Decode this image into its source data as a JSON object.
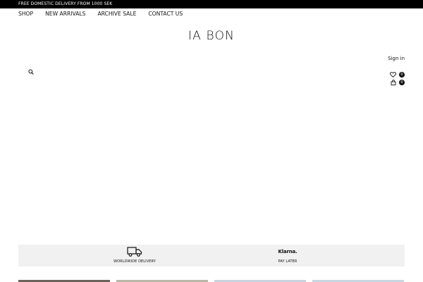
{
  "announcement": "FREE DOMESTIC DELIVERY FROM 1000 SEK",
  "nav": {
    "items": [
      {
        "label": "SHOP"
      },
      {
        "label": "NEW ARRIVALS"
      },
      {
        "label": "ARCHIVE SALE"
      },
      {
        "label": "CONTACT US"
      }
    ]
  },
  "brand": "IA BON",
  "header": {
    "signin_label": "Sign in",
    "wishlist_count": "0",
    "cart_count": "0"
  },
  "icons": {
    "search": "search-icon",
    "wishlist": "heart-icon",
    "cart": "shopping-bag-icon",
    "delivery": "truck-icon",
    "payment": "klarna-logo"
  },
  "features": {
    "delivery_label": "WORLDWIDE DELIVERY",
    "klarna_logo_text": "Klarna.",
    "paylater_label": "PAY LATER"
  },
  "colors": {
    "topbar": "#000000",
    "feature_bg": "#f1f1f1",
    "text": "#111111"
  },
  "thumbnails": [
    {
      "color": "#6b625c"
    },
    {
      "color": "#b9b7a8"
    },
    {
      "color": "#c9d3de"
    },
    {
      "color": "#c7d6df"
    }
  ]
}
